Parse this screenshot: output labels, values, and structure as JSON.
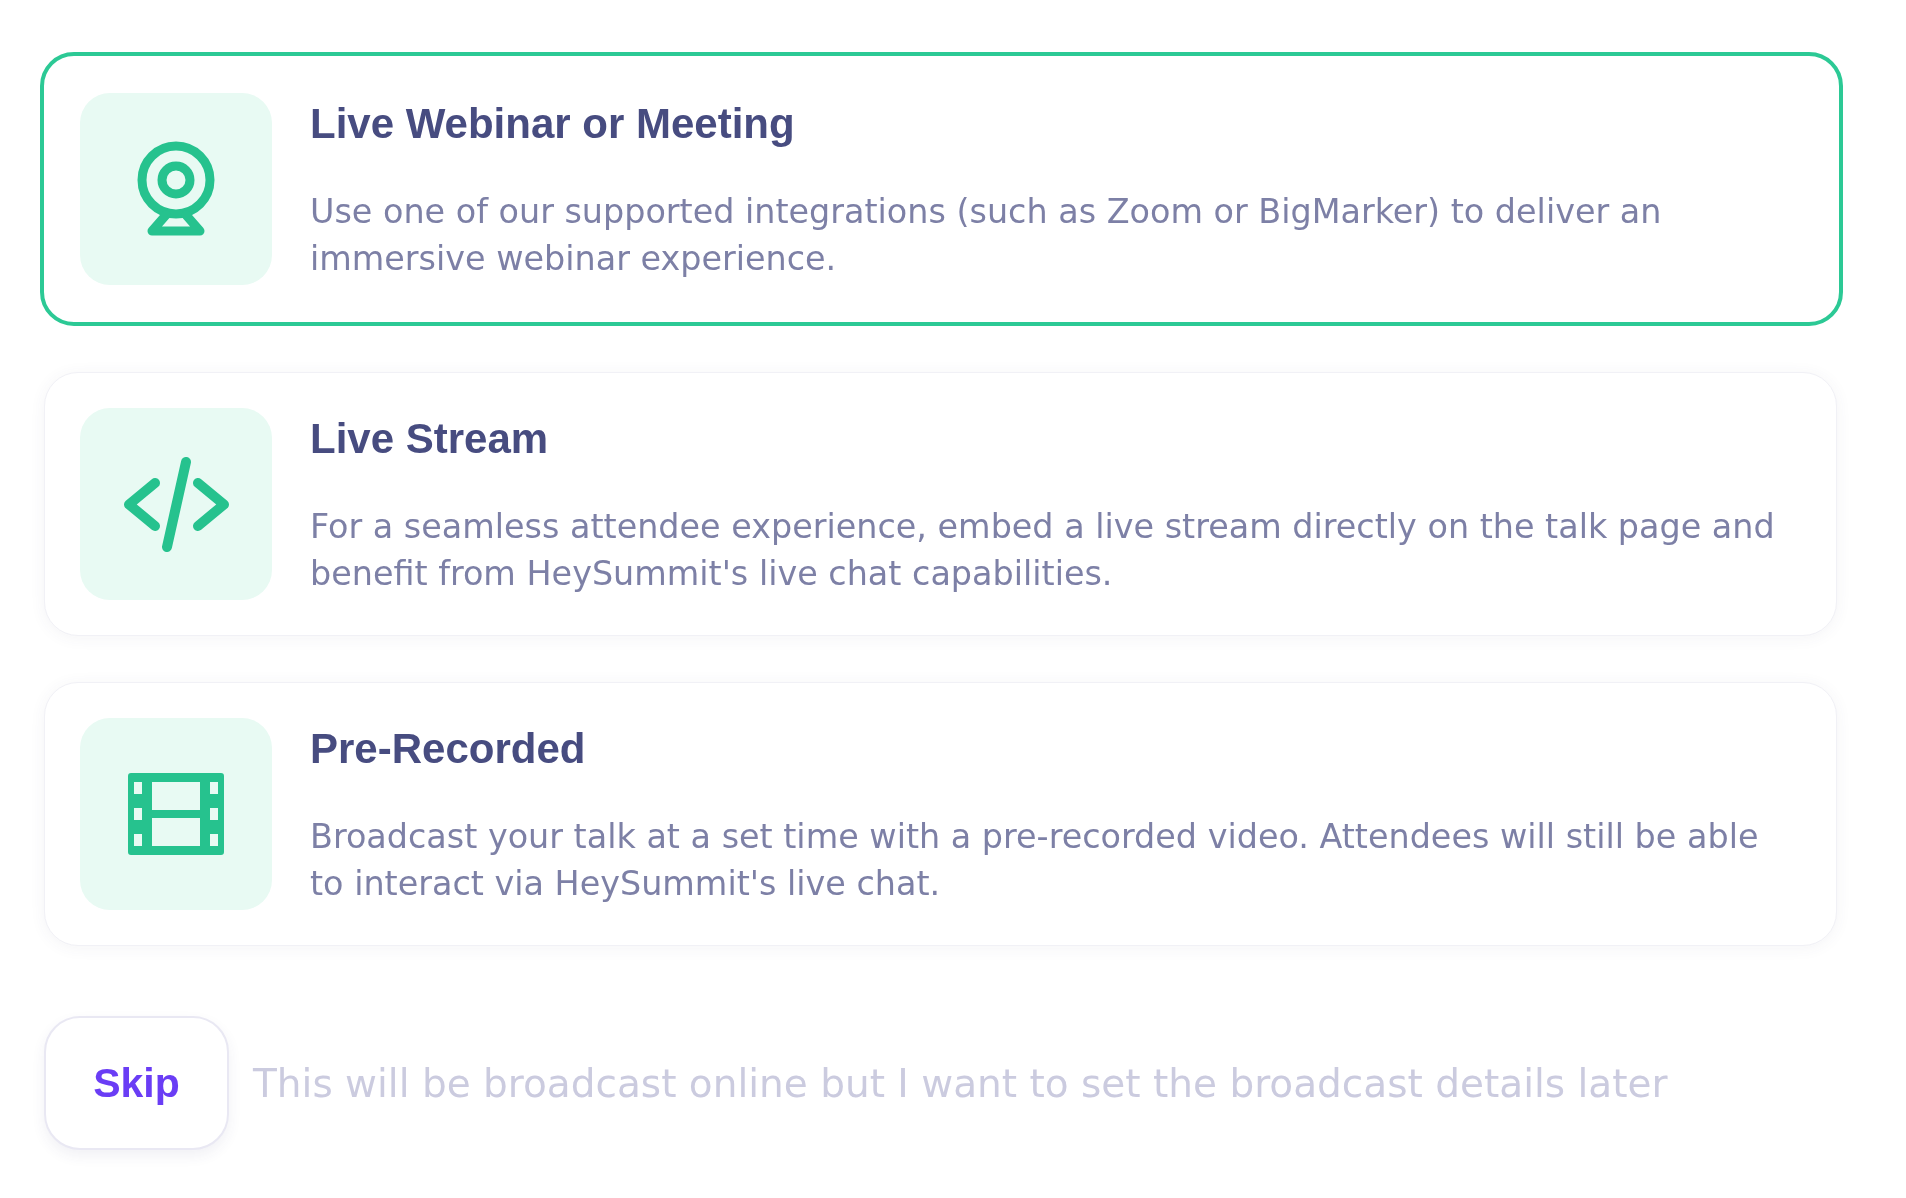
{
  "options": [
    {
      "kind": "webcam",
      "title": "Live Webinar or Meeting",
      "description": "Use one of our supported integrations (such as Zoom or BigMarker) to deliver an immersive webinar experience.",
      "selected": true
    },
    {
      "kind": "code",
      "title": "Live Stream",
      "description": "For a seamless attendee experience, embed a live stream directly on the talk page and benefit from HeySummit's live chat capabilities.",
      "selected": false
    },
    {
      "kind": "film",
      "title": "Pre-Recorded",
      "description": "Broadcast your talk at a set time with a pre-recorded video. Attendees will still be able to interact via HeySummit's live chat.",
      "selected": false
    }
  ],
  "skip": {
    "button": "Skip",
    "note": "This will be broadcast online but I want to set the broadcast details later"
  }
}
